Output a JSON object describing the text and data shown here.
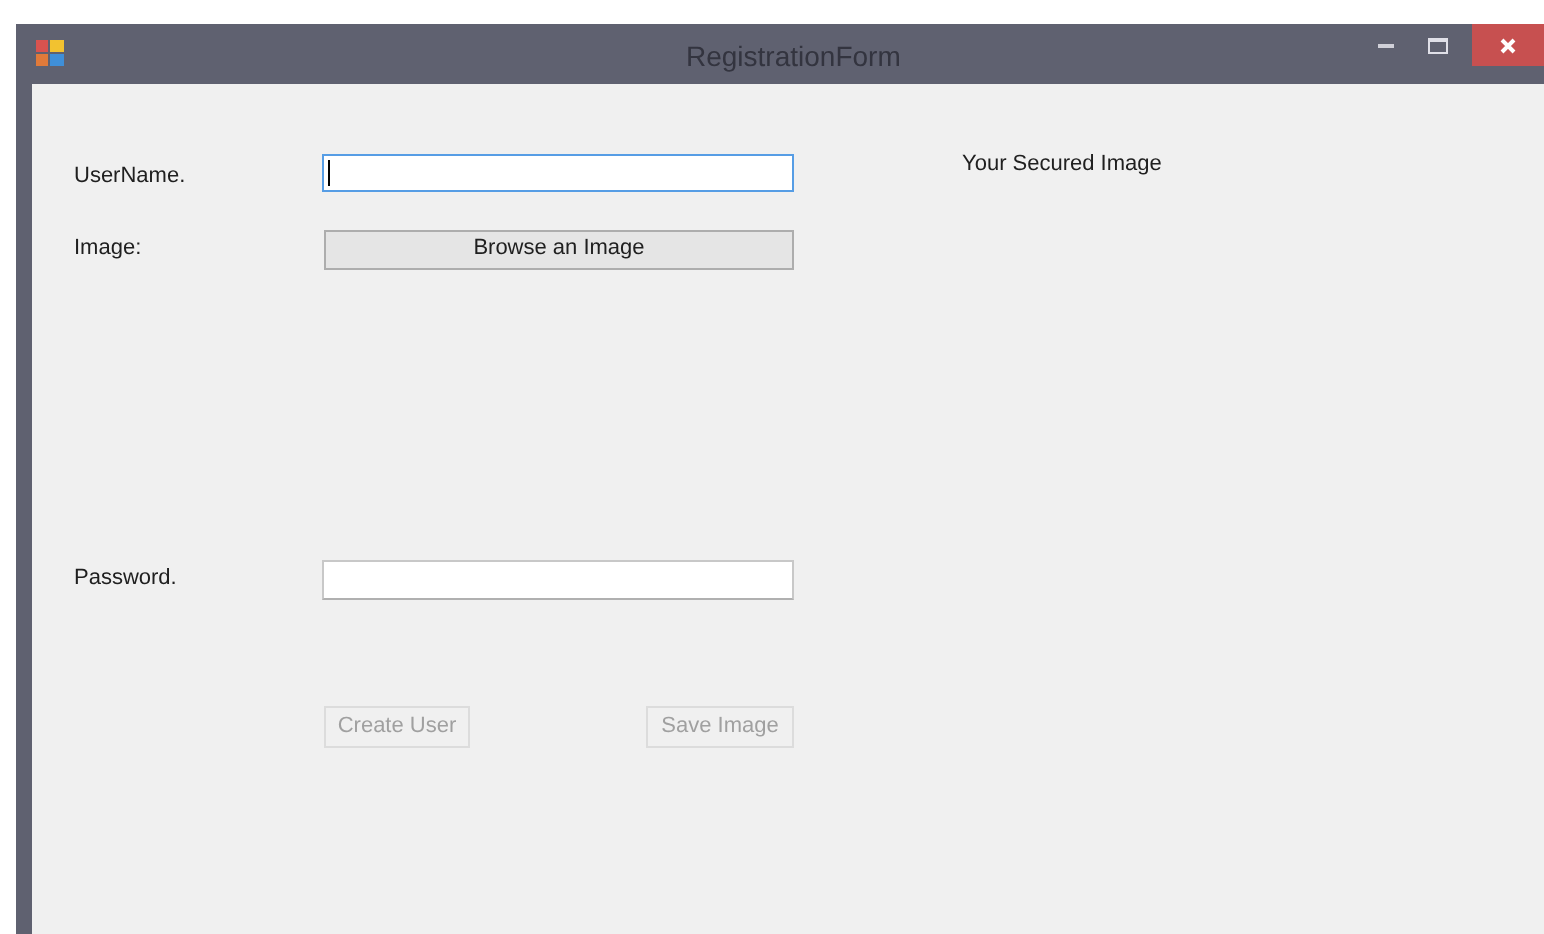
{
  "window": {
    "title": "RegistrationForm",
    "active": false
  },
  "form": {
    "username": {
      "label": "UserName.",
      "focused": true
    },
    "image": {
      "label": "Image:",
      "button": "Browse an Image"
    },
    "password": {
      "label": "Password.",
      "focused": false
    },
    "buttons": [
      {
        "label": "Create User",
        "disabled": true
      },
      {
        "label": "Save Image",
        "disabled": true
      }
    ],
    "preview_label": "Your Secured Image"
  }
}
